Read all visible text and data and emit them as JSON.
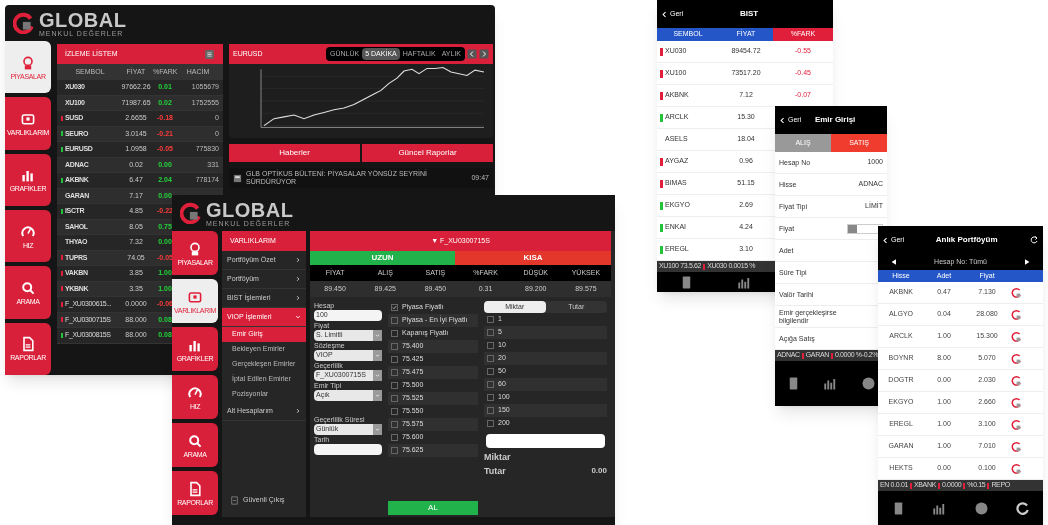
{
  "tablet_1": {
    "logo": {
      "title": "GLOBAL",
      "subtitle": "MENKUL DEĞERLER"
    },
    "nav": [
      {
        "label": "PİYASALAR",
        "selected": true
      },
      {
        "label": "VARLIKLARIM",
        "selected": false
      },
      {
        "label": "GRAFİKLER",
        "selected": false
      },
      {
        "label": "HIZ",
        "selected": false
      },
      {
        "label": "ARAMA",
        "selected": false
      },
      {
        "label": "RAPORLAR",
        "selected": false
      }
    ],
    "watchlist": {
      "title": "İZLEME LİSTEM",
      "columns": [
        "SEMBOL",
        "FİYAT",
        "%FARK",
        "HACİM"
      ],
      "rows": [
        {
          "symbol": "XU030",
          "price": "97662.26",
          "change": "0.01",
          "volume": "1055679"
        },
        {
          "symbol": "XU100",
          "price": "71987.65",
          "change": "0.02",
          "volume": "1752555"
        },
        {
          "symbol": "SUSD",
          "price": "2.6655",
          "change": "-0.18",
          "volume": "0",
          "color": "#e0203a"
        },
        {
          "symbol": "SEURO",
          "price": "3.0145",
          "change": "-0.21",
          "volume": "0",
          "color": "#22c23a"
        },
        {
          "symbol": "EURUSD",
          "price": "1.0958",
          "change": "-0.05",
          "volume": "775830",
          "color": "#22c23a"
        },
        {
          "symbol": "ADNAC",
          "price": "0.02",
          "change": "0.00",
          "volume": "331"
        },
        {
          "symbol": "AKBNK",
          "price": "6.47",
          "change": "2.04",
          "volume": "778174",
          "color": "#22c23a"
        },
        {
          "symbol": "GARAN",
          "price": "7.17",
          "change": "0.00"
        },
        {
          "symbol": "ISCTR",
          "price": "4.85",
          "change": "-0.22",
          "color": "#22c23a"
        },
        {
          "symbol": "SAHOL",
          "price": "8.05",
          "change": "0.75"
        },
        {
          "symbol": "THYAO",
          "price": "7.32",
          "change": "0.00"
        },
        {
          "symbol": "TUPRS",
          "price": "74.05",
          "change": "-0.05",
          "color": "#e0203a"
        },
        {
          "symbol": "VAKBN",
          "price": "3.85",
          "change": "1.00",
          "color": "#e0203a"
        },
        {
          "symbol": "YKBNK",
          "price": "3.35",
          "change": "1.00",
          "color": "#e0203a"
        },
        {
          "symbol": "F_XU0300615...",
          "price": "0.0000",
          "change": "-0.06",
          "color": "#e0203a"
        },
        {
          "symbol": "F_XU0300715S",
          "price": "88.000",
          "change": "0.08",
          "color": "#e0203a"
        },
        {
          "symbol": "F_XU0300815S",
          "price": "88.000",
          "change": "0.08",
          "color": "#22c23a"
        }
      ]
    },
    "chart": {
      "title": "EURUSD",
      "ranges": [
        {
          "label": "GÜNLÜK",
          "selected": false
        },
        {
          "label": "5 DAKİKA",
          "selected": true
        },
        {
          "label": "HAFTALIK",
          "selected": false
        },
        {
          "label": "AYLIK",
          "selected": false
        }
      ]
    },
    "buttons": [
      "Haberler",
      "Güncel Raporlar"
    ],
    "news": {
      "text": "GLB OPTİKUS BÜLTENİ: PİYASALAR YÖNSÜZ SEYRİNİ SÜRDÜRÜYOR",
      "time": "09:47"
    }
  },
  "tablet_2": {
    "logo": {
      "title": "GLOBAL",
      "subtitle": "MENKUL DEĞERLER"
    },
    "nav": [
      {
        "label": "PİYASALAR",
        "selected": false
      },
      {
        "label": "VARLIKLARIM",
        "selected": true
      },
      {
        "label": "GRAFİKLER",
        "selected": false
      },
      {
        "label": "HIZ",
        "selected": false
      },
      {
        "label": "ARAMA",
        "selected": false
      },
      {
        "label": "RAPORLAR",
        "selected": false
      }
    ],
    "menu": {
      "title": "VARLIKLARIM",
      "items": [
        {
          "label": "Portföyüm Özet",
          "expanded": false,
          "selected": false
        },
        {
          "label": "Portföyüm",
          "expanded": false,
          "selected": false
        },
        {
          "label": "BIST İşlemleri",
          "expanded": false,
          "selected": false
        },
        {
          "label": "VIOP İşlemleri",
          "expanded": true,
          "selected": true,
          "children": [
            {
              "label": "Emir Giriş",
              "selected": true
            },
            {
              "label": "Bekleyen Emirler",
              "selected": false
            },
            {
              "label": "Gerçekleşen Emirler",
              "selected": false
            },
            {
              "label": "İptal Edilen Emirler",
              "selected": false
            },
            {
              "label": "Pozisyonlar",
              "selected": false
            }
          ]
        },
        {
          "label": "Alt Hesaplarım",
          "expanded": false,
          "selected": false
        }
      ],
      "logout": "Güvenli Çıkış"
    },
    "contract": "▼ F_XU0300715S",
    "sides": [
      {
        "label": "UZUN",
        "color": "#22b24c"
      },
      {
        "label": "KISA",
        "color": "#e2372a"
      }
    ],
    "quote_columns": [
      "FİYAT",
      "ALIŞ",
      "SATIŞ",
      "%FARK",
      "DÜŞÜK",
      "YÜKSEK"
    ],
    "quote_values": [
      "89.450",
      "89.425",
      "89.450",
      "0.31",
      "89.200",
      "89.575"
    ],
    "form": [
      {
        "label": "Hesap",
        "value": "100",
        "kind": "input"
      },
      {
        "label": "Fiyat",
        "value": "S. Limitli",
        "kind": "select"
      },
      {
        "label": "Sözleşme",
        "value": "VIOP",
        "kind": "select"
      },
      {
        "label": "Geçerlilik",
        "value": "F_XU0300715S",
        "kind": "select"
      },
      {
        "label": "Emir Tipi",
        "value": "Açık",
        "kind": "select"
      },
      {
        "label": "Geçerlilik Süresi",
        "value": "Günlük",
        "kind": "select"
      },
      {
        "label": "Tarih",
        "kind": "input"
      }
    ],
    "price_options": [
      {
        "label": "Piyasa Fiyatlı",
        "checked": true
      },
      {
        "label": "Piyasa - En İyi Fiyatlı",
        "checked": false
      },
      {
        "label": "Kapanış Fiyatlı",
        "checked": false
      },
      {
        "label": "75.400",
        "checked": false
      },
      {
        "label": "75.425",
        "checked": false
      },
      {
        "label": "75.475",
        "checked": false
      },
      {
        "label": "75.500",
        "checked": false
      },
      {
        "label": "75.525",
        "checked": false
      },
      {
        "label": "75.550",
        "checked": false
      },
      {
        "label": "75.575",
        "checked": false
      },
      {
        "label": "75.600",
        "checked": false
      },
      {
        "label": "75.625",
        "checked": false
      }
    ],
    "buy_button": "AL",
    "mode_tabs": [
      {
        "label": "Miktar",
        "selected": true
      },
      {
        "label": "Tutar",
        "selected": false
      }
    ],
    "quantities": [
      {
        "label": "1",
        "checked": false
      },
      {
        "label": "5",
        "checked": false
      },
      {
        "label": "10",
        "checked": false
      },
      {
        "label": "20",
        "checked": false
      },
      {
        "label": "50",
        "checked": false
      },
      {
        "label": "60",
        "checked": false
      },
      {
        "label": "100",
        "checked": false
      },
      {
        "label": "150",
        "checked": false
      },
      {
        "label": "200",
        "checked": false
      }
    ],
    "quantity_label": "Miktar",
    "total_label": "Tutar",
    "total_value": "0.00"
  },
  "phone_1": {
    "back": "Geri",
    "title": "BIST",
    "columns": [
      "SEMBOL",
      "FİYAT",
      "%FARK"
    ],
    "rows": [
      {
        "symbol": "XU030",
        "price": "89454.72",
        "change": "-0.55",
        "color": "#e0203a"
      },
      {
        "symbol": "XU100",
        "price": "73517.20",
        "change": "-0.45",
        "color": "#e0203a"
      },
      {
        "symbol": "AKBNK",
        "price": "7.12",
        "change": "-0.07",
        "color": "#e0203a"
      },
      {
        "symbol": "ARCLK",
        "price": "15.30",
        "color": "#22c23a"
      },
      {
        "symbol": "ASELS",
        "price": "18.04"
      },
      {
        "symbol": "AYGAZ",
        "price": "0.96",
        "color": "#e0203a"
      },
      {
        "symbol": "BIMAS",
        "price": "51.15",
        "color": "#e0203a"
      },
      {
        "symbol": "EKGYO",
        "price": "2.69",
        "color": "#22c23a"
      },
      {
        "symbol": "ENKAI",
        "price": "4.24",
        "color": "#22c23a"
      },
      {
        "symbol": "EREGL",
        "price": "3.10",
        "color": "#22c23a"
      }
    ],
    "ticker": [
      "XU100 73.5.62",
      "XU030 0.0015 %"
    ]
  },
  "phone_2": {
    "back": "Geri",
    "title": "Emir Girişi",
    "sides": [
      {
        "label": "ALIŞ",
        "selected": false
      },
      {
        "label": "SATIŞ",
        "selected": true
      }
    ],
    "fields": [
      {
        "label": "Hesap No",
        "value": "1000",
        "kind": "text"
      },
      {
        "label": "Hisse",
        "value": "ADNAC",
        "kind": "text"
      },
      {
        "label": "Fiyat Tipi",
        "value": "LİMİT",
        "kind": "text"
      },
      {
        "label": "Fiyat",
        "kind": "stepper"
      },
      {
        "label": "Adet",
        "kind": "text"
      },
      {
        "label": "Süre Tipi",
        "kind": "text"
      },
      {
        "label": "Valör Tarihi",
        "kind": "text"
      },
      {
        "label": "Emir gerçekleşirse bilgilendir",
        "kind": "text"
      },
      {
        "label": "Açığa Satış",
        "kind": "text"
      }
    ],
    "ticker": [
      "ADNAC",
      "GARAN",
      "0.0000 %-0.2%"
    ]
  },
  "phone_3": {
    "back": "Geri",
    "title": "Anlık Portföyüm",
    "account": "Hesap No: Tümü",
    "columns": [
      "Hisse",
      "Adet",
      "Fiyat"
    ],
    "rows": [
      {
        "symbol": "AKBNK",
        "qty": "0.47",
        "price": "7.130"
      },
      {
        "symbol": "ALGYO",
        "qty": "0.04",
        "price": "28.080"
      },
      {
        "symbol": "ARCLK",
        "qty": "1.00",
        "price": "15.300"
      },
      {
        "symbol": "BOYNR",
        "qty": "8.00",
        "price": "5.070"
      },
      {
        "symbol": "DOGTR",
        "qty": "0.00",
        "price": "2.030"
      },
      {
        "symbol": "EKGYO",
        "qty": "1.00",
        "price": "2.660"
      },
      {
        "symbol": "EREGL",
        "qty": "1.00",
        "price": "3.100"
      },
      {
        "symbol": "GARAN",
        "qty": "1.00",
        "price": "7.010"
      },
      {
        "symbol": "HEKTS",
        "qty": "0.00",
        "price": "0.100"
      }
    ],
    "ticker": [
      "EN 0.0.01",
      "XBANK",
      "0.0000",
      "%0.15",
      "REPO"
    ]
  }
}
